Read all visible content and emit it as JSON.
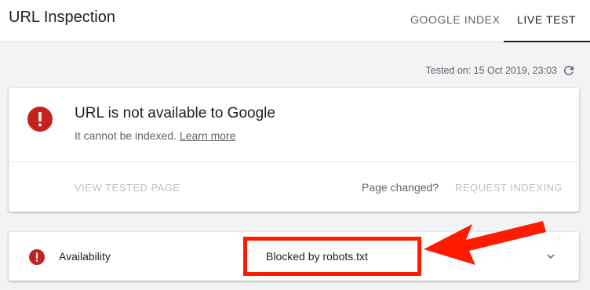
{
  "header": {
    "title": "URL Inspection",
    "tabs": [
      {
        "label": "GOOGLE INDEX"
      },
      {
        "label": "LIVE TEST"
      }
    ]
  },
  "tested": {
    "text": "Tested on: 15 Oct 2019, 23:03"
  },
  "status_card": {
    "heading": "URL is not available to Google",
    "subtext": "It cannot be indexed.",
    "learn_more": "Learn more",
    "view_tested_page": "VIEW TESTED PAGE",
    "page_changed": "Page changed?",
    "request_indexing": "REQUEST INDEXING"
  },
  "availability": {
    "label": "Availability",
    "value": "Blocked by robots.txt"
  },
  "colors": {
    "error_red": "#c5221f",
    "annotation_red": "#ff1a00"
  },
  "icons": [
    "error-icon",
    "refresh-icon",
    "chevron-down-icon"
  ]
}
